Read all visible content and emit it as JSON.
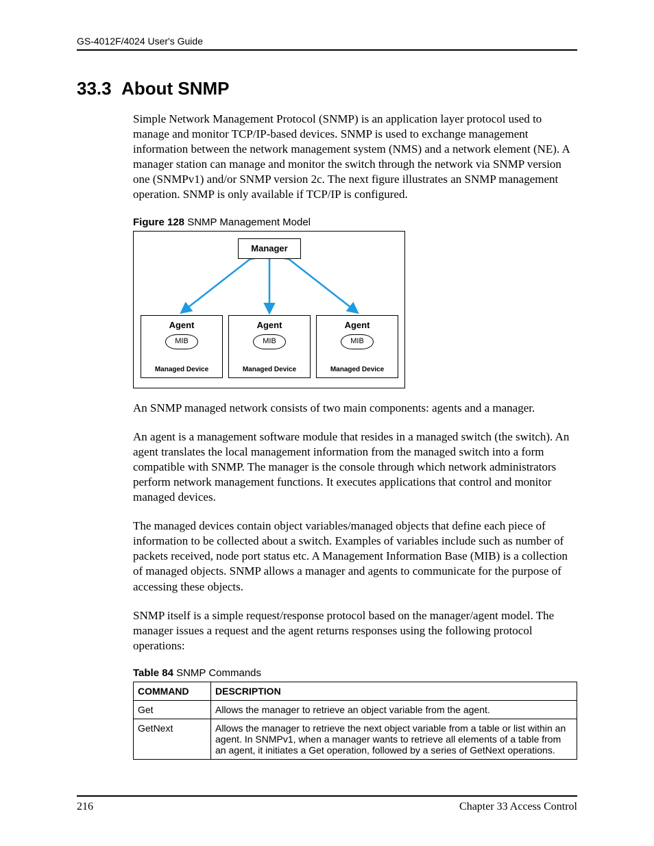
{
  "header": {
    "guide": "GS-4012F/4024 User's Guide"
  },
  "section": {
    "number": "33.3",
    "title": "About SNMP"
  },
  "paragraphs": {
    "p1": "Simple Network Management Protocol (SNMP) is an application layer protocol used to manage and monitor TCP/IP-based devices.  SNMP is used to exchange management information between the network management system (NMS) and a network element (NE). A manager station can manage and monitor the switch through the network via SNMP version one (SNMPv1) and/or SNMP version 2c. The next figure illustrates an SNMP management operation. SNMP is only available if TCP/IP is configured.",
    "p2": "An SNMP managed network consists of two main components: agents and a manager.",
    "p3": "An agent is a management software module that resides in a managed switch (the switch). An agent translates the local management information from the managed switch into a form compatible with SNMP. The manager is the console through which network administrators perform network management functions. It executes applications that control and monitor managed devices.",
    "p4": "The managed devices contain object variables/managed objects that define each piece of information to be collected about a switch. Examples of variables include such as number of packets received, node port status etc. A Management Information Base (MIB) is a collection of managed objects.  SNMP allows a manager and agents to communicate for the purpose of accessing these objects.",
    "p5": "SNMP itself is a simple request/response protocol based on the manager/agent model. The manager issues a request and the agent returns responses using the following protocol operations:"
  },
  "figure": {
    "lead": "Figure 128",
    "title": "   SNMP Management Model",
    "manager": "Manager",
    "agent": "Agent",
    "mib": "MIB",
    "managed": "Managed Device"
  },
  "table": {
    "lead": "Table 84",
    "title": "   SNMP Commands",
    "headers": {
      "c1": "COMMAND",
      "c2": "DESCRIPTION"
    },
    "rows": [
      {
        "cmd": "Get",
        "desc": "Allows the manager to retrieve an object variable from the agent."
      },
      {
        "cmd": "GetNext",
        "desc": "Allows the manager to retrieve the next object variable from a table or list within an agent. In SNMPv1, when a manager wants to retrieve all elements of a table from an agent, it initiates a Get operation, followed by a series of GetNext operations."
      }
    ]
  },
  "footer": {
    "page": "216",
    "chapter": "Chapter 33 Access Control"
  }
}
